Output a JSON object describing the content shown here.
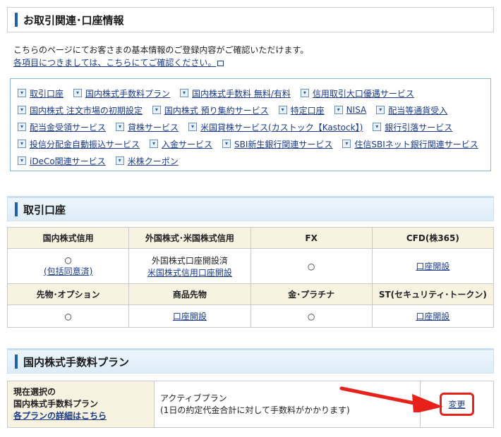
{
  "header": {
    "title": "お取引関連･口座情報"
  },
  "intro": {
    "line1": "こちらのページにてお客さまの基本情報のご登録内容がご確認いただけます。",
    "help_link": "各項目につきましては、こちらにてご確認ください。"
  },
  "links": [
    [
      "取引口座",
      "国内株式手数料プラン",
      "国内株式手数料 無料/有料",
      "信用取引大口優遇サービス"
    ],
    [
      "国内株式 注文市場の初期設定",
      "国内株式 預り集約サービス",
      "特定口座",
      "NISA",
      "配当等通貨受入"
    ],
    [
      "配当金受領サービス",
      "貸株サービス",
      "米国貸株サービス(カストック【Kastock】)",
      "銀行引落サービス"
    ],
    [
      "投信分配金自動振込サービス",
      "入金サービス",
      "SBI新生銀行関連サービス",
      "住信SBIネット銀行関連サービス"
    ],
    [
      "iDeCo関連サービス",
      "米株クーポン"
    ]
  ],
  "account_section": {
    "title": "取引口座",
    "headers1": [
      "国内株式信用",
      "外国株式･米国株式信用",
      "FX",
      "CFD(株365)"
    ],
    "row1": {
      "c1_mark": "○",
      "c1_link": "(包括同意済)",
      "c2_text": "外国株式口座開設済",
      "c2_link": "米国株式信用口座開設",
      "c3": "○",
      "c4_link": "口座開設"
    },
    "headers2": [
      "先物･オプション",
      "商品先物",
      "金･プラチナ",
      "ST(セキュリティ･トークン)"
    ],
    "row2": {
      "c1": "○",
      "c2_link": "口座開設",
      "c3": "○",
      "c4_link": "口座開設"
    }
  },
  "plan_section": {
    "title": "国内株式手数料プラン",
    "label_line1": "現在選択の",
    "label_line2": "国内株式手数料プラン",
    "label_link": "各プランの詳細はこちら",
    "plan_name": "アクティブプラン",
    "plan_desc": "(1日の約定代金合計に対して手数料がかかります)",
    "change_label": "変更"
  },
  "colors": {
    "accent": "#1f5fae",
    "highlight": "#e8221a",
    "header_bg": "#f7f3e0"
  }
}
